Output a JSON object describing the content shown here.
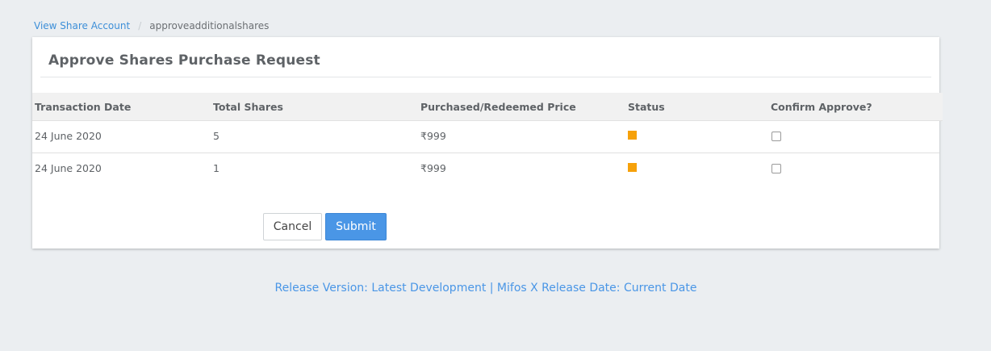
{
  "breadcrumb": {
    "link": "View Share Account",
    "separator": "/",
    "current": "approveadditionalshares"
  },
  "panel": {
    "title": "Approve Shares Purchase Request"
  },
  "table": {
    "headers": [
      "Transaction Date",
      "Total Shares",
      "Purchased/Redeemed Price",
      "Status",
      "Confirm Approve?"
    ],
    "rows": [
      {
        "date": "24 June 2020",
        "shares": "5",
        "price": "₹999",
        "status_color": "#f6a10a",
        "checked": false
      },
      {
        "date": "24 June 2020",
        "shares": "1",
        "price": "₹999",
        "status_color": "#f6a10a",
        "checked": false
      }
    ]
  },
  "buttons": {
    "cancel": "Cancel",
    "submit": "Submit"
  },
  "footer": {
    "text": "Release Version: Latest Development | Mifos X Release Date: Current Date"
  },
  "colors": {
    "accent": "#4a96e6",
    "status_pending": "#f6a10a"
  }
}
